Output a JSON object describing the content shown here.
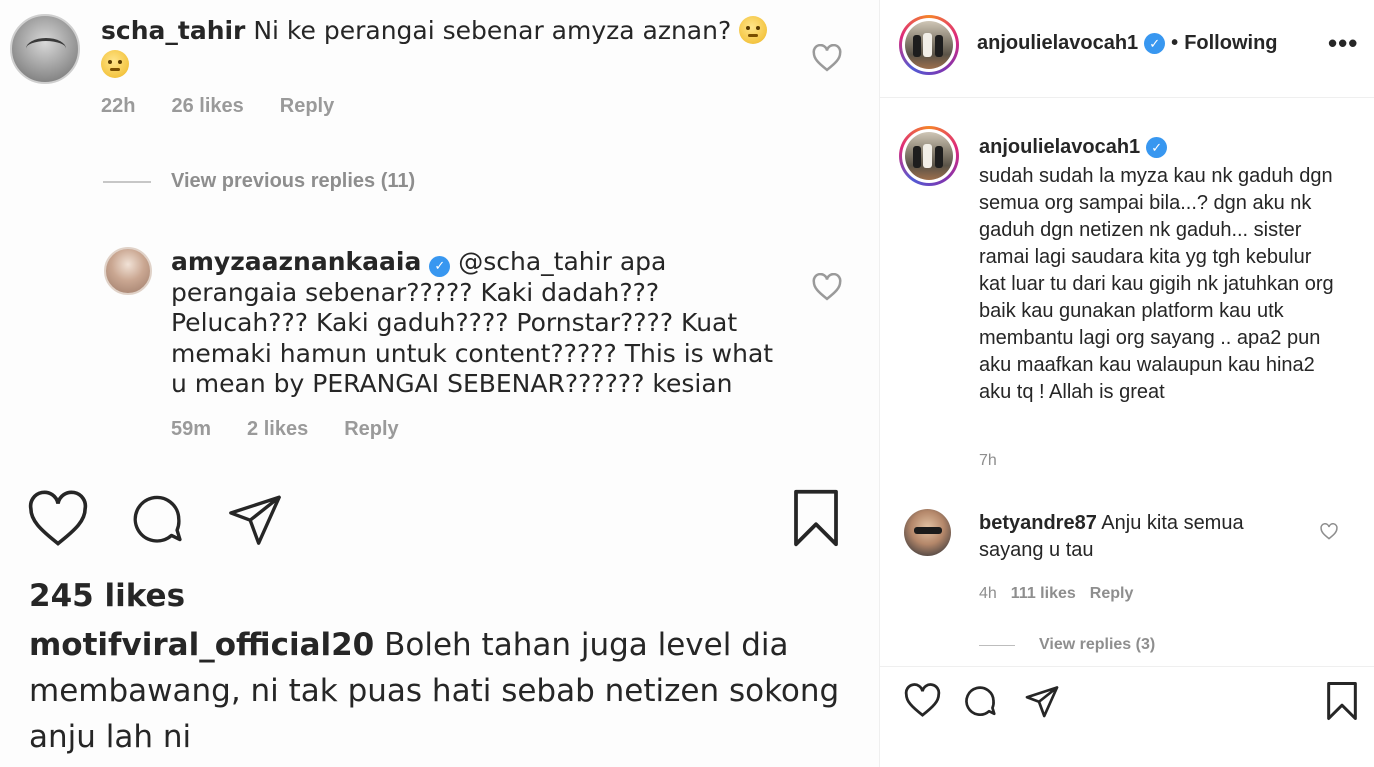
{
  "image_panel": {
    "comment1": {
      "user": "scha_tahir",
      "text": " Ni ke perangai sebenar  amyza aznan? ",
      "time": "22h",
      "likes": "26 likes",
      "reply": "Reply"
    },
    "view_previous": "View previous replies (11)",
    "comment2": {
      "user": "amyzaaznankaaia",
      "text": " @scha_tahir  apa perangaia sebenar????? Kaki dadah??? Pelucah??? Kaki gaduh???? Pornstar???? Kuat memaki hamun untuk content????? This is what u mean by PERANGAI SEBENAR?????? kesian",
      "time": "59m",
      "likes": "2 likes",
      "reply": "Reply"
    },
    "likes": "245 likes",
    "caption": {
      "user": "motifviral_official20",
      "text": " Boleh tahan juga level dia membawang, ni tak puas hati sebab netizen sokong anju lah ni"
    }
  },
  "header": {
    "username": "anjoulielavocah1",
    "separator": "•",
    "follow_status": "Following",
    "more": "•••"
  },
  "caption": {
    "username": "anjoulielavocah1",
    "text": "sudah sudah la myza kau nk gaduh dgn semua org sampai bila...? dgn aku nk gaduh dgn netizen nk gaduh... sister ramai lagi saudara kita yg tgh kebulur kat luar tu dari kau gigih nk jatuhkan org baik kau gunakan platform kau utk membantu lagi org sayang .. apa2 pun aku maafkan kau walaupun kau hina2 aku tq ! Allah is great",
    "time": "7h"
  },
  "comment": {
    "username": "betyandre87",
    "text": " Anju kita semua sayang u tau",
    "time": "4h",
    "likes": "111 likes",
    "reply": "Reply",
    "view_replies": "View replies (3)"
  },
  "icons": {
    "verified": "✓"
  }
}
